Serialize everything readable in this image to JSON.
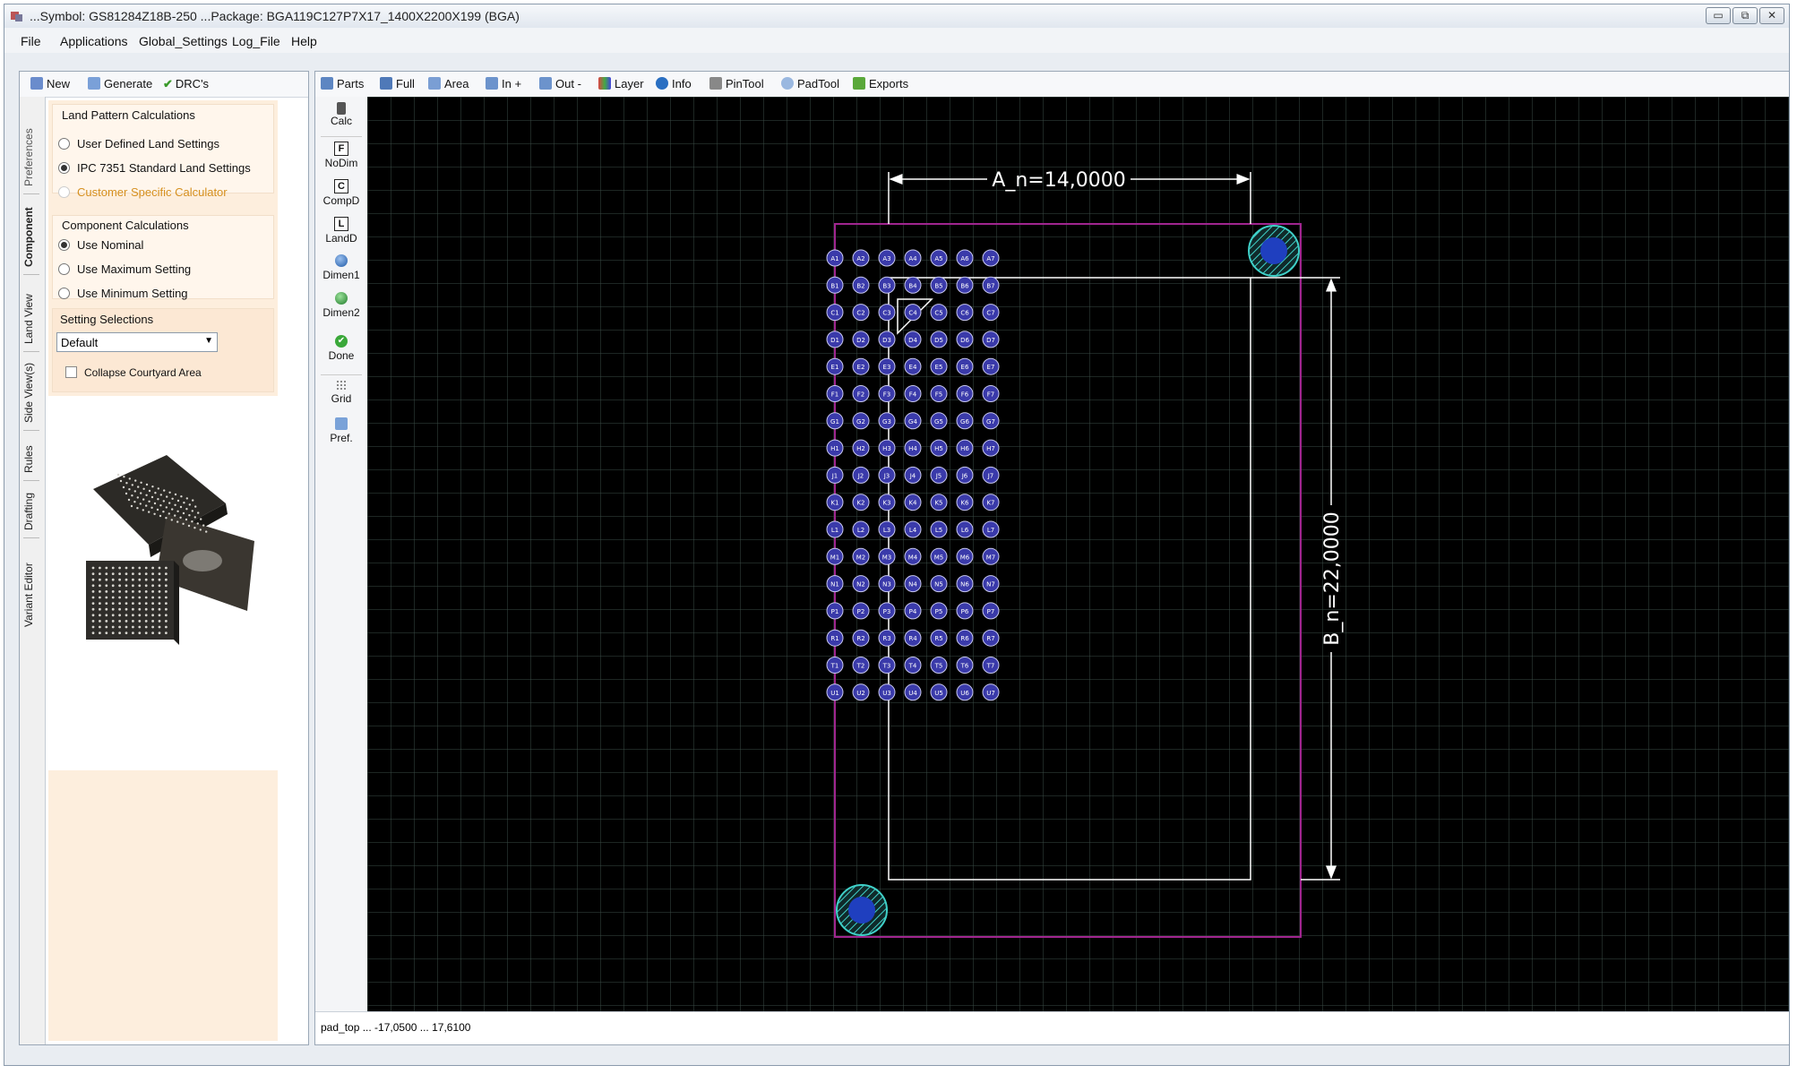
{
  "window": {
    "title": "...Symbol: GS81284Z18B-250 ...Package: BGA119C127P7X17_1400X2200X199  (BGA)",
    "controls": {
      "minimize": "▭",
      "restore": "⧉",
      "close": "✕"
    }
  },
  "menu": [
    "File",
    "Applications",
    "Global_Settings",
    "Log_File",
    "Help"
  ],
  "side_toolbar": {
    "new": "New",
    "generate": "Generate",
    "drcs": "DRC's"
  },
  "vertical_tabs": [
    "Preferences",
    "Component",
    "Land View",
    "Side View(s)",
    "Rules",
    "Drafting",
    "Variant Editor"
  ],
  "land_pattern": {
    "title": "Land Pattern Calculations",
    "options": [
      {
        "label": "User Defined Land Settings",
        "selected": false,
        "enabled": true
      },
      {
        "label": "IPC 7351 Standard Land Settings",
        "selected": true,
        "enabled": true
      },
      {
        "label": "Customer Specific Calculator",
        "selected": false,
        "enabled": false
      }
    ]
  },
  "component_calc": {
    "title": "Component Calculations",
    "options": [
      {
        "label": "Use Nominal",
        "selected": true
      },
      {
        "label": "Use Maximum Setting",
        "selected": false
      },
      {
        "label": "Use Minimum Setting",
        "selected": false
      }
    ]
  },
  "setting_selections": {
    "title": "Setting Selections",
    "selected": "Default",
    "collapse_label": "Collapse Courtyard Area",
    "collapse_checked": false
  },
  "main_toolbar": {
    "parts": "Parts",
    "full": "Full",
    "area": "Area",
    "zoom_in": "In +",
    "zoom_out": "Out -",
    "layer": "Layer",
    "info": "Info",
    "pintool": "PinTool",
    "padtool": "PadTool",
    "exports": "Exports"
  },
  "commands": [
    "Calc",
    "NoDim",
    "CompD",
    "LandD",
    "Dimen1",
    "Dimen2",
    "Done",
    "Grid",
    "Pref."
  ],
  "command_letters": {
    "nodim": "F",
    "compd": "C",
    "landd": "L"
  },
  "dimensions": {
    "a": "A_n=14,0000",
    "b": "B_n=22,0000"
  },
  "grid": {
    "rows": [
      "A",
      "B",
      "C",
      "D",
      "E",
      "F",
      "G",
      "H",
      "J",
      "K",
      "L",
      "M",
      "N",
      "P",
      "R",
      "T",
      "U"
    ],
    "columns": 7
  },
  "status": "pad_top ... -17,0500 ... 17,6100",
  "colors": {
    "courtyard": "#a0258f",
    "pad": "#3a3aaa",
    "dimension": "#ffffff",
    "fiducial": "#3fd0c8"
  }
}
